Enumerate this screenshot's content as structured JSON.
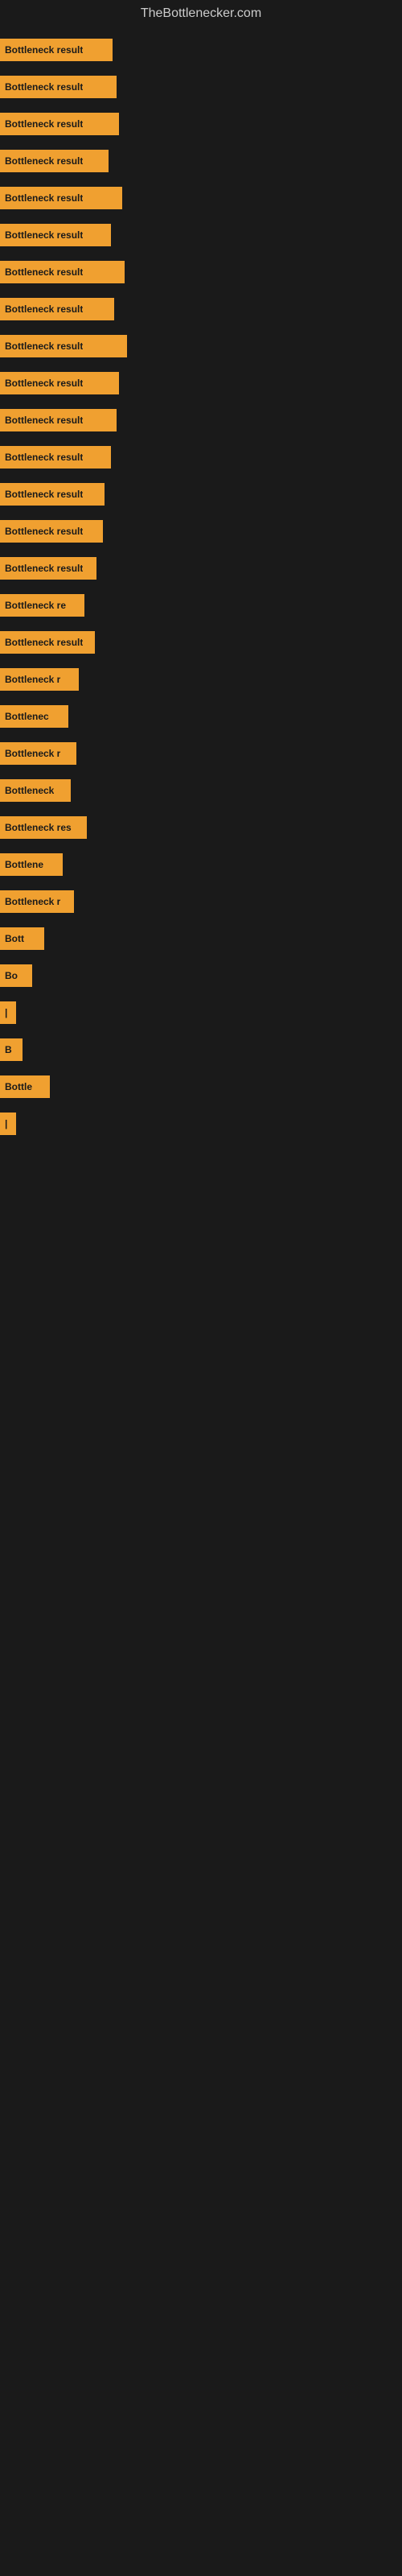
{
  "siteTitle": "TheBottlenecker.com",
  "bars": [
    {
      "label": "Bottleneck result",
      "width": 140
    },
    {
      "label": "Bottleneck result",
      "width": 145
    },
    {
      "label": "Bottleneck result",
      "width": 148
    },
    {
      "label": "Bottleneck result",
      "width": 135
    },
    {
      "label": "Bottleneck result",
      "width": 152
    },
    {
      "label": "Bottleneck result",
      "width": 138
    },
    {
      "label": "Bottleneck result",
      "width": 155
    },
    {
      "label": "Bottleneck result",
      "width": 142
    },
    {
      "label": "Bottleneck result",
      "width": 158
    },
    {
      "label": "Bottleneck result",
      "width": 148
    },
    {
      "label": "Bottleneck result",
      "width": 145
    },
    {
      "label": "Bottleneck result",
      "width": 138
    },
    {
      "label": "Bottleneck result",
      "width": 130
    },
    {
      "label": "Bottleneck result",
      "width": 128
    },
    {
      "label": "Bottleneck result",
      "width": 120
    },
    {
      "label": "Bottleneck re",
      "width": 105
    },
    {
      "label": "Bottleneck result",
      "width": 118
    },
    {
      "label": "Bottleneck r",
      "width": 98
    },
    {
      "label": "Bottlenec",
      "width": 85
    },
    {
      "label": "Bottleneck r",
      "width": 95
    },
    {
      "label": "Bottleneck",
      "width": 88
    },
    {
      "label": "Bottleneck res",
      "width": 108
    },
    {
      "label": "Bottlene",
      "width": 78
    },
    {
      "label": "Bottleneck r",
      "width": 92
    },
    {
      "label": "Bott",
      "width": 55
    },
    {
      "label": "Bo",
      "width": 40
    },
    {
      "label": "|",
      "width": 18
    },
    {
      "label": "B",
      "width": 28
    },
    {
      "label": "Bottle",
      "width": 62
    },
    {
      "label": "|",
      "width": 15
    }
  ]
}
